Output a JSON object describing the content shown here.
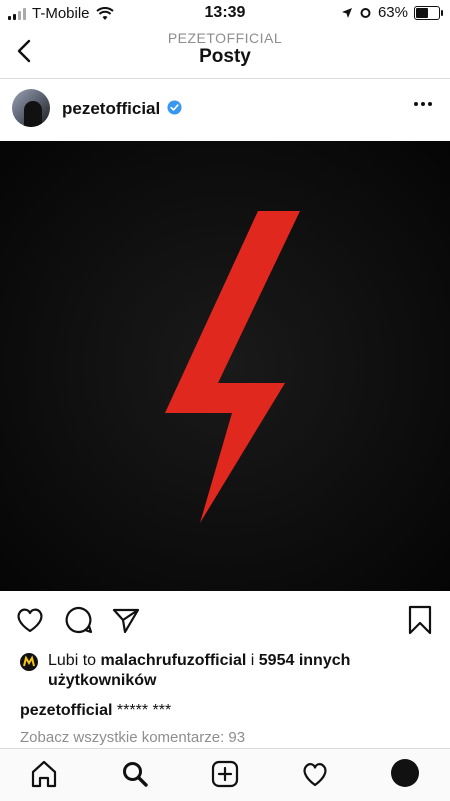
{
  "status_bar": {
    "carrier": "T-Mobile",
    "time": "13:39",
    "battery": "63%",
    "battery_level": 0.63
  },
  "nav": {
    "account": "PEZETOFFICIAL",
    "title": "Posty"
  },
  "post": {
    "username": "pezetofficial",
    "verified": true,
    "image_icon": "red-lightning-bolt",
    "likes": {
      "prefix": "Lubi to",
      "liker": "malachrufuzofficial",
      "joiner": "i",
      "others": "5954 innych użytkowników"
    },
    "caption": {
      "user": "pezetofficial",
      "text": "***** ***"
    },
    "comments_link": "Zobacz wszystkie komentarze: 93"
  },
  "colors": {
    "bolt": "#e0281e",
    "photo_bg": "#0b0b0b",
    "muted": "#8e8e8e",
    "verified": "#3897f0"
  },
  "icons": [
    "back-icon",
    "more-icon",
    "heart-icon",
    "comment-icon",
    "share-icon",
    "bookmark-icon",
    "home-icon",
    "search-icon",
    "add-icon",
    "activity-heart-icon",
    "profile-avatar"
  ]
}
